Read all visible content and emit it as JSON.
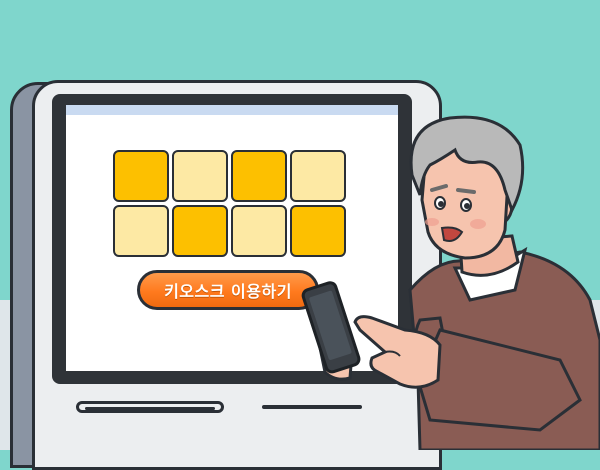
{
  "kiosk": {
    "tiles": [
      "dark",
      "light",
      "dark",
      "light",
      "light",
      "dark",
      "light",
      "dark"
    ],
    "button_label": "키오스크 이용하기"
  },
  "colors": {
    "background": "#7fd6cc",
    "tile_dark": "#fdc000",
    "tile_light": "#fde9a4",
    "button_orange": "#ff7a1e",
    "sweater": "#8a5c54"
  },
  "icons": {
    "person": "elderly-man-illustration",
    "phone": "smartphone-icon"
  }
}
